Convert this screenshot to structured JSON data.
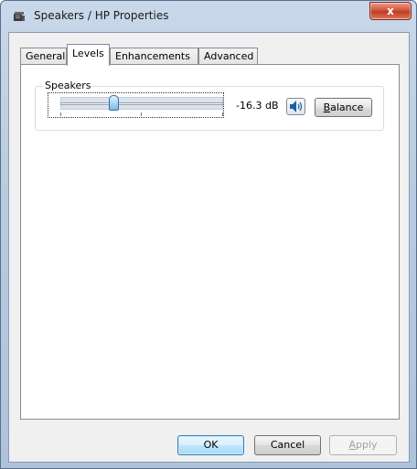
{
  "window": {
    "title": "Speakers / HP Properties",
    "close_label": "x"
  },
  "tabs": [
    {
      "label": "General",
      "active": false
    },
    {
      "label": "Levels",
      "active": true
    },
    {
      "label": "Enhancements",
      "active": false
    },
    {
      "label": "Advanced",
      "active": false
    }
  ],
  "levels": {
    "group_label": "Speakers",
    "slider_fraction": 0.33,
    "value_text": "-16.3 dB",
    "mute_icon": "speaker-volume-icon",
    "balance_label_prefix": "",
    "balance_label_mnemonic": "B",
    "balance_label_rest": "alance"
  },
  "footer": {
    "ok_label": "OK",
    "cancel_label": "Cancel",
    "apply_mnemonic": "A",
    "apply_rest": "pply"
  },
  "colors": {
    "accent": "#3c7fb1",
    "close_button": "#c23b22"
  }
}
